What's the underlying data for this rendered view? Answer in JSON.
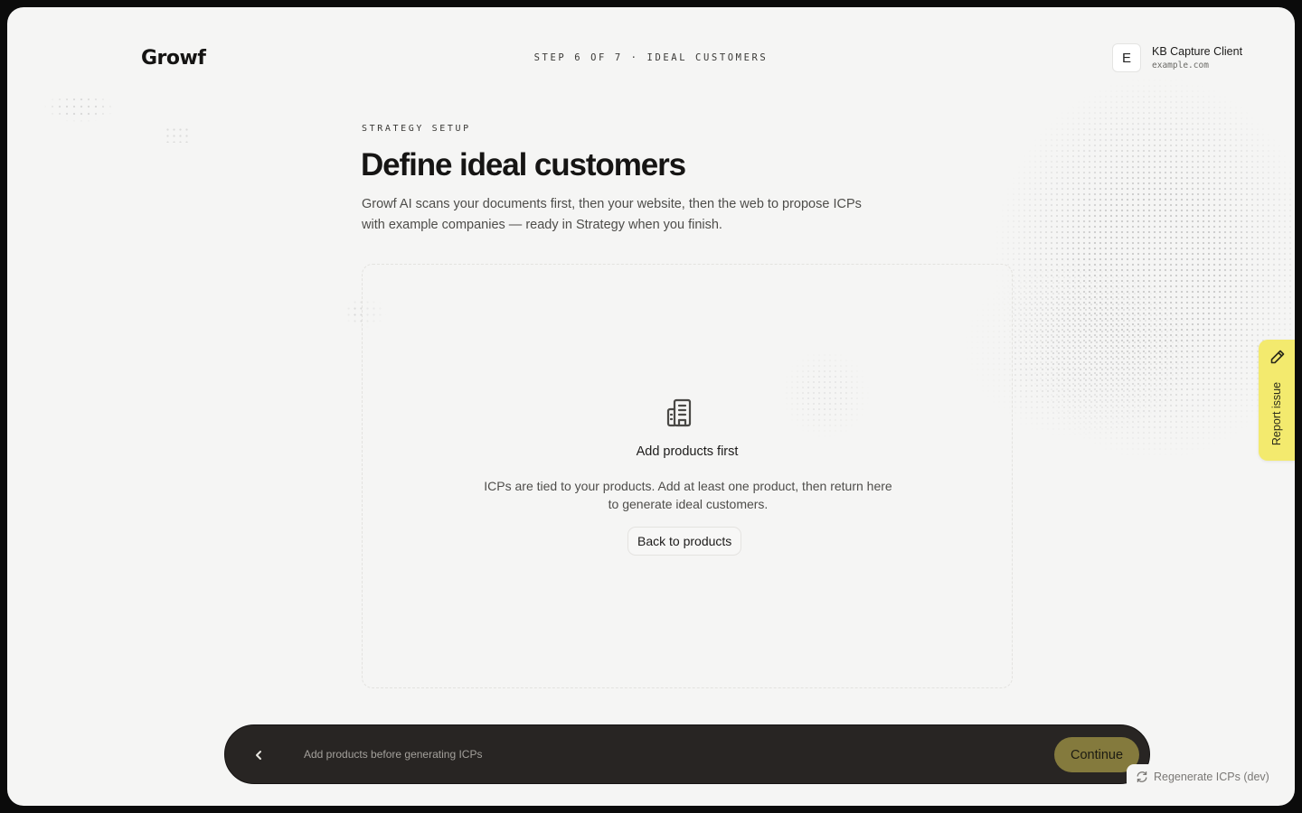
{
  "brand": {
    "logo_text": "Growf"
  },
  "header": {
    "step_indicator": "STEP 6 OF 7 · IDEAL CUSTOMERS",
    "account": {
      "avatar_letter": "E",
      "name": "KB Capture Client",
      "domain": "example.com"
    }
  },
  "main": {
    "eyebrow": "STRATEGY SETUP",
    "title": "Define ideal customers",
    "subtitle": "Growf AI scans your documents first, then your website, then the web to propose ICPs with example companies — ready in Strategy when you finish.",
    "empty_state": {
      "icon": "building-icon",
      "title": "Add products first",
      "description": "ICPs are tied to your products. Add at least one product, then return here to generate ideal customers.",
      "button_label": "Back to products"
    }
  },
  "report_tab": {
    "label": "Report issue",
    "icon": "pencil-icon",
    "color": "#f3ea6e"
  },
  "footer_bar": {
    "back_icon": "chevron-left-icon",
    "message": "Add products before generating ICPs",
    "continue_label": "Continue",
    "continue_color": "#847a3d"
  },
  "dev": {
    "regenerate_label": "Regenerate ICPs (dev)",
    "icon": "refresh-icon"
  }
}
